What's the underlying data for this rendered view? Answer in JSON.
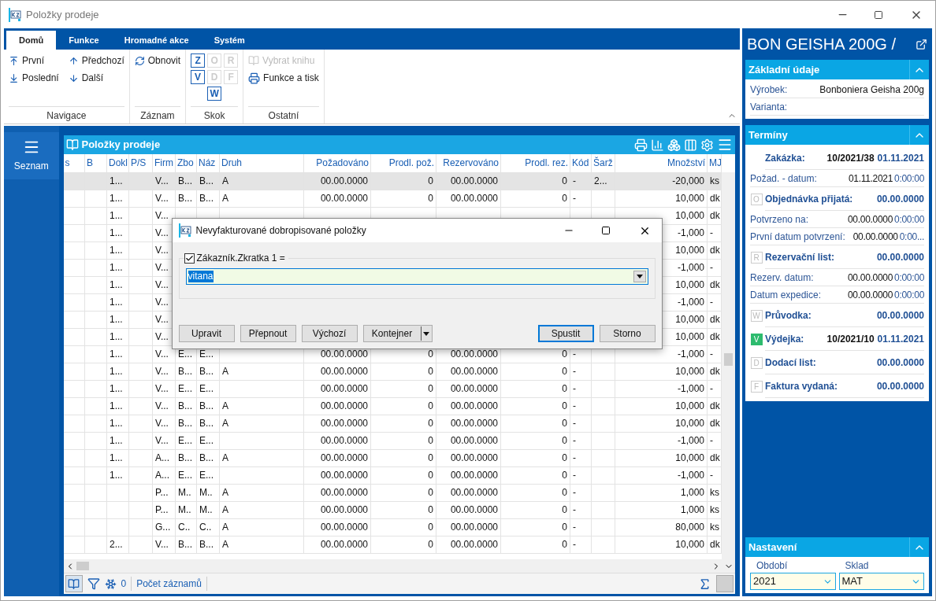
{
  "window": {
    "title": "Položky prodeje"
  },
  "ribbon": {
    "tabs": [
      {
        "label": "Domů",
        "selected": true
      },
      {
        "label": "Funkce",
        "selected": false
      },
      {
        "label": "Hromadné akce",
        "selected": false
      },
      {
        "label": "Systém",
        "selected": false
      }
    ],
    "groups": [
      {
        "kind": "nav",
        "label": "Navigace",
        "items": [
          {
            "label": "První"
          },
          {
            "label": "Předchozí"
          },
          {
            "label": "Poslední"
          },
          {
            "label": "Další"
          }
        ]
      },
      {
        "kind": "record",
        "label": "Záznam",
        "items": [
          {
            "label": "Obnovit"
          }
        ]
      },
      {
        "kind": "jump",
        "label": "Skok",
        "items": [
          {
            "label": "Z",
            "disabled": false
          },
          {
            "label": "O",
            "disabled": true
          },
          {
            "label": "R",
            "disabled": true
          },
          {
            "label": "V",
            "disabled": false
          },
          {
            "label": "D",
            "disabled": true
          },
          {
            "label": "F",
            "disabled": true
          },
          {
            "label": "W",
            "disabled": false
          }
        ]
      },
      {
        "kind": "other",
        "label": "Ostatní",
        "items": [
          {
            "label": "Vybrat knihu",
            "disabled": true
          },
          {
            "label": "Funkce a tisk",
            "disabled": false
          }
        ]
      }
    ]
  },
  "sidebar": {
    "items": [
      {
        "label": "Seznam",
        "selected": true
      }
    ]
  },
  "table": {
    "title": "Položky prodeje",
    "columns": [
      "s",
      "B",
      "Dokl",
      "P/S",
      "Firm",
      "Zbo",
      "Náz",
      "Druh",
      "Požadováno",
      "Prodl. pož.",
      "Rezervováno",
      "Prodl. rez.",
      "Kód",
      "Šarž",
      "Množství",
      "MJ"
    ],
    "rows": [
      {
        "selected": true,
        "cells": [
          null,
          null,
          "1...",
          null,
          "V...",
          "B...",
          "B...",
          "A",
          "00.00.0000",
          "0",
          "00.00.0000",
          "0",
          "-",
          "2...",
          "-20,000",
          "ks"
        ]
      },
      {
        "selected": false,
        "cells": [
          null,
          null,
          "1...",
          null,
          "V...",
          "B...",
          "B...",
          "A",
          "00.00.0000",
          "0",
          "00.00.0000",
          "0",
          "-",
          null,
          "10,000",
          "dk"
        ]
      },
      {
        "selected": false,
        "cells": [
          null,
          null,
          "1...",
          null,
          "V...",
          null,
          null,
          null,
          null,
          null,
          null,
          null,
          null,
          null,
          "10,000",
          "dk"
        ]
      },
      {
        "selected": false,
        "cells": [
          null,
          null,
          "1...",
          null,
          "V...",
          null,
          null,
          null,
          null,
          null,
          null,
          null,
          null,
          null,
          "-1,000",
          "-"
        ]
      },
      {
        "selected": false,
        "cells": [
          null,
          null,
          "1...",
          null,
          "V...",
          null,
          null,
          null,
          null,
          null,
          null,
          null,
          null,
          null,
          "10,000",
          "dk"
        ]
      },
      {
        "selected": false,
        "cells": [
          null,
          null,
          "1...",
          null,
          "V...",
          null,
          null,
          null,
          null,
          null,
          null,
          null,
          null,
          null,
          "-1,000",
          "-"
        ]
      },
      {
        "selected": false,
        "cells": [
          null,
          null,
          "1...",
          null,
          "V...",
          null,
          null,
          null,
          null,
          null,
          null,
          null,
          null,
          null,
          "10,000",
          "dk"
        ]
      },
      {
        "selected": false,
        "cells": [
          null,
          null,
          "1...",
          null,
          "V...",
          null,
          null,
          null,
          null,
          null,
          null,
          null,
          null,
          null,
          "-1,000",
          "-"
        ]
      },
      {
        "selected": false,
        "cells": [
          null,
          null,
          "1...",
          null,
          "V...",
          null,
          null,
          null,
          null,
          null,
          null,
          null,
          null,
          null,
          "10,000",
          "dk"
        ]
      },
      {
        "selected": false,
        "cells": [
          null,
          null,
          "1...",
          null,
          "V...",
          null,
          null,
          null,
          null,
          null,
          null,
          null,
          null,
          null,
          "10,000",
          "dk"
        ]
      },
      {
        "selected": false,
        "cells": [
          null,
          null,
          "1...",
          null,
          "V...",
          "E...",
          "E...",
          null,
          "00.00.0000",
          "0",
          "00.00.0000",
          "0",
          "-",
          null,
          "-1,000",
          "-"
        ]
      },
      {
        "selected": false,
        "cells": [
          null,
          null,
          "1...",
          null,
          "V...",
          "B...",
          "B...",
          "A",
          "00.00.0000",
          "0",
          "00.00.0000",
          "0",
          "-",
          null,
          "10,000",
          "dk"
        ]
      },
      {
        "selected": false,
        "cells": [
          null,
          null,
          "1...",
          null,
          "V...",
          "E...",
          "E...",
          null,
          "00.00.0000",
          "0",
          "00.00.0000",
          "0",
          "-",
          null,
          "-1,000",
          "-"
        ]
      },
      {
        "selected": false,
        "cells": [
          null,
          null,
          "1...",
          null,
          "V...",
          "B...",
          "B...",
          "A",
          "00.00.0000",
          "0",
          "00.00.0000",
          "0",
          "-",
          null,
          "10,000",
          "dk"
        ]
      },
      {
        "selected": false,
        "cells": [
          null,
          null,
          "1...",
          null,
          "V...",
          "B...",
          "B...",
          "A",
          "00.00.0000",
          "0",
          "00.00.0000",
          "0",
          "-",
          null,
          "10,000",
          "dk"
        ]
      },
      {
        "selected": false,
        "cells": [
          null,
          null,
          "1...",
          null,
          "V...",
          "E...",
          "E...",
          null,
          "00.00.0000",
          "0",
          "00.00.0000",
          "0",
          "-",
          null,
          "-1,000",
          "-"
        ]
      },
      {
        "selected": false,
        "cells": [
          null,
          null,
          "1...",
          null,
          "A...",
          "B...",
          "B...",
          "A",
          "00.00.0000",
          "0",
          "00.00.0000",
          "0",
          "-",
          null,
          "10,000",
          "dk"
        ]
      },
      {
        "selected": false,
        "cells": [
          null,
          null,
          "1...",
          null,
          "A...",
          "E...",
          "E...",
          null,
          "00.00.0000",
          "0",
          "00.00.0000",
          "0",
          "-",
          null,
          "-1,000",
          "-"
        ]
      },
      {
        "selected": false,
        "cells": [
          null,
          null,
          null,
          null,
          "P...",
          "M..",
          "M..",
          "A",
          "00.00.0000",
          "0",
          "00.00.0000",
          "0",
          "-",
          null,
          "1,000",
          "ks"
        ]
      },
      {
        "selected": false,
        "cells": [
          null,
          null,
          null,
          null,
          "P...",
          "M..",
          "M..",
          "A",
          "00.00.0000",
          "0",
          "00.00.0000",
          "0",
          "-",
          null,
          "1,000",
          "ks"
        ]
      },
      {
        "selected": false,
        "cells": [
          null,
          null,
          null,
          null,
          "G...",
          "C..",
          "C..",
          "A",
          "00.00.0000",
          "0",
          "00.00.0000",
          "0",
          "-",
          null,
          "80,000",
          "ks"
        ]
      },
      {
        "selected": false,
        "cells": [
          null,
          null,
          "2...",
          null,
          "V...",
          "B...",
          "B...",
          "A",
          "00.00.0000",
          "0",
          "00.00.0000",
          "0",
          "-",
          null,
          "10,000",
          "dk"
        ]
      }
    ],
    "status_bar": {
      "count": "0",
      "label": "Počet záznamů"
    }
  },
  "dialog": {
    "title": "Nevyfakturované dobropisované položky",
    "filter": {
      "label": "Zákazník.Zkratka 1 =",
      "checked": true,
      "value": "vitana"
    },
    "buttons": [
      {
        "label": "Upravit",
        "kind": "plain"
      },
      {
        "label": "Přepnout",
        "kind": "plain"
      },
      {
        "label": "Výchozí",
        "kind": "plain"
      },
      {
        "label": "Kontejner",
        "kind": "split"
      },
      {
        "label": "Spustit",
        "kind": "default"
      },
      {
        "label": "Storno",
        "kind": "plain"
      }
    ]
  },
  "detail": {
    "title": "BON GEISHA 200G /",
    "sections": [
      {
        "title": "Základní údaje",
        "expanded": true,
        "rows": [
          {
            "kind": "field",
            "label": "Výrobek:",
            "value": "Bonboniera Geisha 200g"
          },
          {
            "kind": "field",
            "label": "Varianta:"
          }
        ]
      },
      {
        "title": "Termíny",
        "expanded": true,
        "rows": [
          {
            "kind": "doc",
            "label": "Zakázka:",
            "number": "10/2021/38",
            "date": "01.11.2021"
          },
          {
            "kind": "date",
            "label": "Požad. - datum:",
            "date": "01.11.2021",
            "time": "0:00:00"
          },
          {
            "kind": "doc",
            "badge": "O",
            "active": false,
            "label": "Objednávka přijatá:",
            "date": "00.00.0000"
          },
          {
            "kind": "date",
            "label": "Potvrzeno na:",
            "date": "00.00.0000",
            "time": "0:00:00"
          },
          {
            "kind": "date",
            "label": "První datum potvrzení:",
            "date": "00.00.0000",
            "time": "0:00..."
          },
          {
            "kind": "doc",
            "badge": "R",
            "active": false,
            "label": "Rezervační list:",
            "date": "00.00.0000"
          },
          {
            "kind": "date",
            "label": "Rezerv. datum:",
            "date": "00.00.0000",
            "time": "0:00:00"
          },
          {
            "kind": "date",
            "label": "Datum expedice:",
            "date": "00.00.0000",
            "time": "0:00:00"
          },
          {
            "kind": "doc",
            "badge": "W",
            "active": false,
            "label": "Průvodka:",
            "date": "00.00.0000"
          },
          {
            "kind": "doc",
            "badge": "V",
            "active": true,
            "label": "Výdejka:",
            "number": "10/2021/10",
            "date": "01.11.2021"
          },
          {
            "kind": "doc",
            "badge": "D",
            "active": false,
            "label": "Dodací list:",
            "date": "00.00.0000"
          },
          {
            "kind": "doc",
            "badge": "F",
            "active": false,
            "label": "Faktura vydaná:",
            "date": "00.00.0000"
          }
        ]
      }
    ],
    "settings": {
      "title": "Nastavení",
      "expanded": true,
      "fields": [
        {
          "label": "Období",
          "value": "2021"
        },
        {
          "label": "Sklad",
          "value": "MAT"
        }
      ]
    }
  }
}
